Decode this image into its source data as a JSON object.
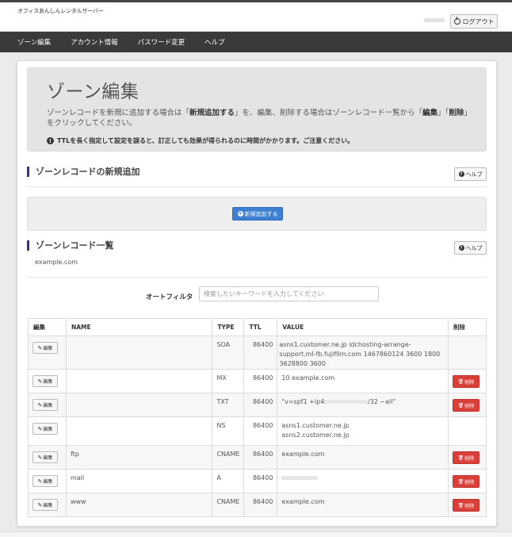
{
  "header": {
    "brand": "オフィスあんしんレンタルサーバー",
    "logout_label": "ログアウト"
  },
  "nav": {
    "items": [
      "ゾーン編集",
      "アカウント情報",
      "パスワード変更",
      "ヘルプ"
    ]
  },
  "page": {
    "title": "ゾーン編集",
    "intro_1": "ゾーンレコードを新規に追加する場合は「",
    "intro_bold_1": "新規追加する",
    "intro_2": "」を、編集、削除する場合はゾーンレコード一覧から「",
    "intro_bold_2": "編集",
    "intro_3": "」「",
    "intro_bold_3": "削除",
    "intro_4": "」をクリックしてください。",
    "notice": "TTLを長く指定して設定を誤ると、訂正しても効果が得られるのに時間がかかります。ご注意ください。"
  },
  "add_section": {
    "title": "ゾーンレコードの新規追加",
    "help_label": "ヘルプ",
    "add_button": "新規追加する"
  },
  "list_section": {
    "title": "ゾーンレコード一覧",
    "help_label": "ヘルプ",
    "domain": "example.com",
    "filter_label": "オートフィルタ",
    "filter_placeholder": "検索したいキーワードを入力してください"
  },
  "table": {
    "headers": [
      "編集",
      "NAME",
      "TYPE",
      "TTL",
      "VALUE",
      "削除"
    ],
    "edit_label": "編集",
    "delete_label": "削除",
    "rows": [
      {
        "name": "",
        "type": "SOA",
        "ttl": "86400",
        "value": "asns1.customer.ne.jp idchosting-arrange-support.ml-fb.fujifilm.com 1467860124 3600 1800 3628800 3600"
      },
      {
        "name": "",
        "type": "MX",
        "ttl": "86400",
        "value": "10 example.com"
      },
      {
        "name": "",
        "type": "TXT",
        "ttl": "86400",
        "value_prefix": "\"v=spf1 +ip4:",
        "value_suffix": "/32 ~all\""
      },
      {
        "name": "",
        "type": "NS",
        "ttl": "86400",
        "value_line1": "asns1.customer.ne.jp",
        "value_line2": "asns2.customer.ne.jp"
      },
      {
        "name": "ftp",
        "type": "CNAME",
        "ttl": "86400",
        "value": "example.com"
      },
      {
        "name": "mail",
        "type": "A",
        "ttl": "86400",
        "value": ""
      },
      {
        "name": "www",
        "type": "CNAME",
        "ttl": "86400",
        "value": "example.com"
      }
    ]
  }
}
